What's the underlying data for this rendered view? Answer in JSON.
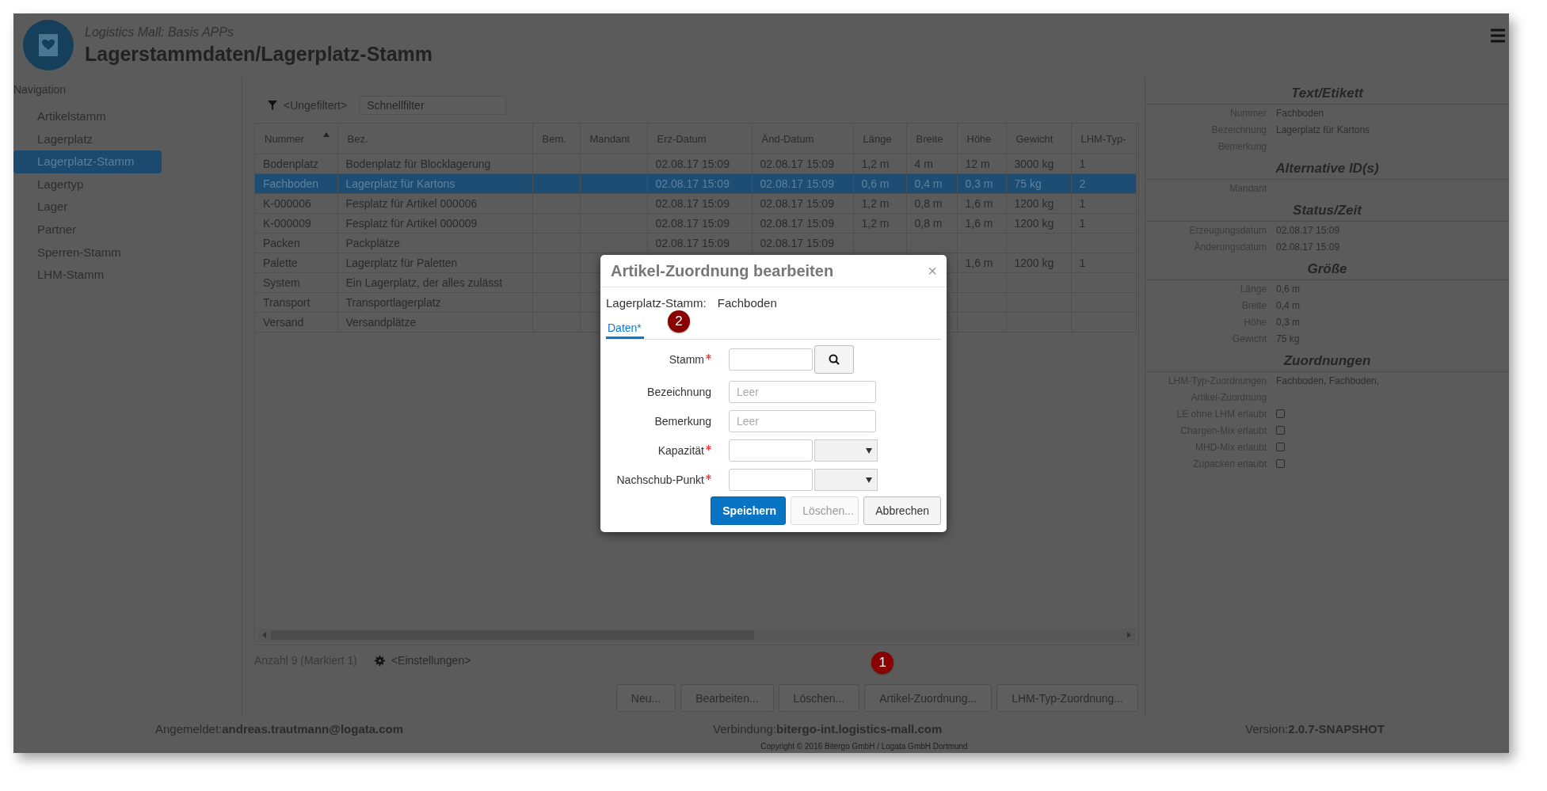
{
  "app": {
    "subtitle": "Logistics Mall: Basis APPs",
    "title": "Lagerstammdaten/Lagerplatz-Stamm"
  },
  "navigation": {
    "title": "Navigation",
    "items": [
      {
        "label": "Artikelstamm",
        "selected": false
      },
      {
        "label": "Lagerplatz",
        "selected": false
      },
      {
        "label": "Lagerplatz-Stamm",
        "selected": true
      },
      {
        "label": "Lagertyp",
        "selected": false
      },
      {
        "label": "Lager",
        "selected": false
      },
      {
        "label": "Partner",
        "selected": false
      },
      {
        "label": "Sperren-Stamm",
        "selected": false
      },
      {
        "label": "LHM-Stamm",
        "selected": false
      }
    ]
  },
  "filter": {
    "label": "<Ungefiltert>",
    "placeholder": "Schnellfilter"
  },
  "table": {
    "columns": [
      {
        "label": "Nummer",
        "sorted": true
      },
      {
        "label": "Bez.",
        "sorted": false
      },
      {
        "label": "Bem.",
        "sorted": false
      },
      {
        "label": "Mandant",
        "sorted": false
      },
      {
        "label": "Erz-Datum",
        "sorted": false
      },
      {
        "label": "Änd-Datum",
        "sorted": false
      },
      {
        "label": "Länge",
        "sorted": false
      },
      {
        "label": "Breite",
        "sorted": false
      },
      {
        "label": "Höhe",
        "sorted": false
      },
      {
        "label": "Gewicht",
        "sorted": false
      },
      {
        "label": "LHM-Typ-",
        "sorted": false
      }
    ],
    "rows": [
      {
        "selected": false,
        "cells": [
          "Bodenplatz",
          "Bodenplatz für Blocklagerung",
          null,
          null,
          "02.08.17 15:09",
          "02.08.17 15:09",
          "1,2 m",
          "4 m",
          "12 m",
          "3000 kg",
          "1"
        ]
      },
      {
        "selected": true,
        "cells": [
          "Fachboden",
          "Lagerplatz für Kartons",
          null,
          null,
          "02.08.17 15:09",
          "02.08.17 15:09",
          "0,6 m",
          "0,4 m",
          "0,3 m",
          "75 kg",
          "2"
        ]
      },
      {
        "selected": false,
        "cells": [
          "K-000006",
          "Fesplatz für Artikel 000006",
          null,
          null,
          "02.08.17 15:09",
          "02.08.17 15:09",
          "1,2 m",
          "0,8 m",
          "1,6 m",
          "1200 kg",
          "1"
        ]
      },
      {
        "selected": false,
        "cells": [
          "K-000009",
          "Fesplatz für Artikel 000009",
          null,
          null,
          "02.08.17 15:09",
          "02.08.17 15:09",
          "1,2 m",
          "0,8 m",
          "1,6 m",
          "1200 kg",
          "1"
        ]
      },
      {
        "selected": false,
        "cells": [
          "Packen",
          "Packplätze",
          null,
          null,
          "02.08.17 15:09",
          "02.08.17 15:09",
          null,
          null,
          null,
          null,
          null
        ]
      },
      {
        "selected": false,
        "cells": [
          "Palette",
          "Lagerplatz für Paletten",
          null,
          null,
          null,
          null,
          null,
          null,
          "1,6 m",
          "1200 kg",
          "1"
        ]
      },
      {
        "selected": false,
        "cells": [
          "System",
          "Ein Lagerplatz, der alles zulässt",
          null,
          null,
          null,
          null,
          null,
          null,
          null,
          null,
          null
        ]
      },
      {
        "selected": false,
        "cells": [
          "Transport",
          "Transportlagerplatz",
          null,
          null,
          null,
          null,
          null,
          null,
          null,
          null,
          null
        ]
      },
      {
        "selected": false,
        "cells": [
          "Versand",
          "Versandplätze",
          null,
          null,
          null,
          null,
          null,
          null,
          null,
          null,
          null
        ]
      }
    ]
  },
  "summary": "Anzahl 9 (Markiert 1)",
  "settings": "<Einstellungen>",
  "buttons": [
    {
      "label": "Neu..."
    },
    {
      "label": "Bearbeiten..."
    },
    {
      "label": "Löschen..."
    },
    {
      "label": "Artikel-Zuordnung...",
      "badge": "1"
    },
    {
      "label": "LHM-Typ-Zuordnung..."
    }
  ],
  "footer": {
    "user": "Angemeldet:**andreas.trautmann@logata.com**",
    "connection": "Verbindung:**bitergo-int.logistics-mall.com**",
    "version": "Version:**2.0.7-SNAPSHOT**",
    "copyright": "Copyright © 2016 Bitergo GmbH / Logata GmbH Dortmund"
  },
  "details": {
    "sections": [
      {
        "title": "Text/Etikett",
        "fields": [
          {
            "kind": "text",
            "label": "Nummer",
            "value": "Fachboden"
          },
          {
            "kind": "text",
            "label": "Bezeichnung",
            "value": "Lagerplatz für Kartons"
          },
          {
            "kind": "text",
            "label": "Bemerkung"
          }
        ]
      },
      {
        "title": "Alternative ID(s)",
        "fields": [
          {
            "kind": "text",
            "label": "Mandant"
          }
        ]
      },
      {
        "title": "Status/Zeit",
        "fields": [
          {
            "kind": "text",
            "label": "Erzeugungsdatum",
            "value": "02.08.17 15:09"
          },
          {
            "kind": "text",
            "label": "Änderungsdatum",
            "value": "02.08.17 15:09"
          }
        ]
      },
      {
        "title": "Größe",
        "fields": [
          {
            "kind": "text",
            "label": "Länge",
            "value": "0,6 m"
          },
          {
            "kind": "text",
            "label": "Breite",
            "value": "0,4 m"
          },
          {
            "kind": "text",
            "label": "Höhe",
            "value": "0,3 m"
          },
          {
            "kind": "text",
            "label": "Gewicht",
            "value": "75 kg"
          }
        ]
      },
      {
        "title": "Zuordnungen",
        "fields": [
          {
            "kind": "text",
            "label": "LHM-Typ-Zuordnungen",
            "value": "Fachboden, Fachboden,"
          },
          {
            "kind": "text",
            "label": "Artikel-Zuordnung"
          },
          {
            "kind": "checkbox",
            "label": "LE ohne LHM erlaubt",
            "checked": false
          },
          {
            "kind": "checkbox",
            "label": "Chargen-Mix erlaubt",
            "checked": false
          },
          {
            "kind": "checkbox",
            "label": "MHD-Mix erlaubt",
            "checked": false
          },
          {
            "kind": "checkbox",
            "label": "Zupacken erlaubt",
            "checked": false
          }
        ]
      }
    ]
  },
  "dialog": {
    "title": "Artikel-Zuordnung bearbeiten",
    "close": "×",
    "context_label": "Lagerplatz-Stamm:",
    "context_value": "Fachboden",
    "tabs": [
      {
        "label": "Daten*",
        "selected": true,
        "badge": "2"
      }
    ],
    "fields": [
      {
        "kind": "lookup",
        "label": "Stamm",
        "required": true
      },
      {
        "kind": "text",
        "label": "Bezeichnung",
        "required": false,
        "placeholder": "Leer"
      },
      {
        "kind": "text",
        "label": "Bemerkung",
        "required": false,
        "placeholder": "Leer"
      },
      {
        "kind": "quantity",
        "label": "Kapazität",
        "required": true
      },
      {
        "kind": "quantity",
        "label": "Nachschub-Punkt",
        "required": true
      }
    ],
    "buttons": [
      {
        "label": "Speichern",
        "kind": "primary",
        "disabled": false
      },
      {
        "label": "Löschen...",
        "kind": "default",
        "disabled": true
      },
      {
        "label": "Abbrechen",
        "kind": "default",
        "disabled": false
      }
    ]
  }
}
